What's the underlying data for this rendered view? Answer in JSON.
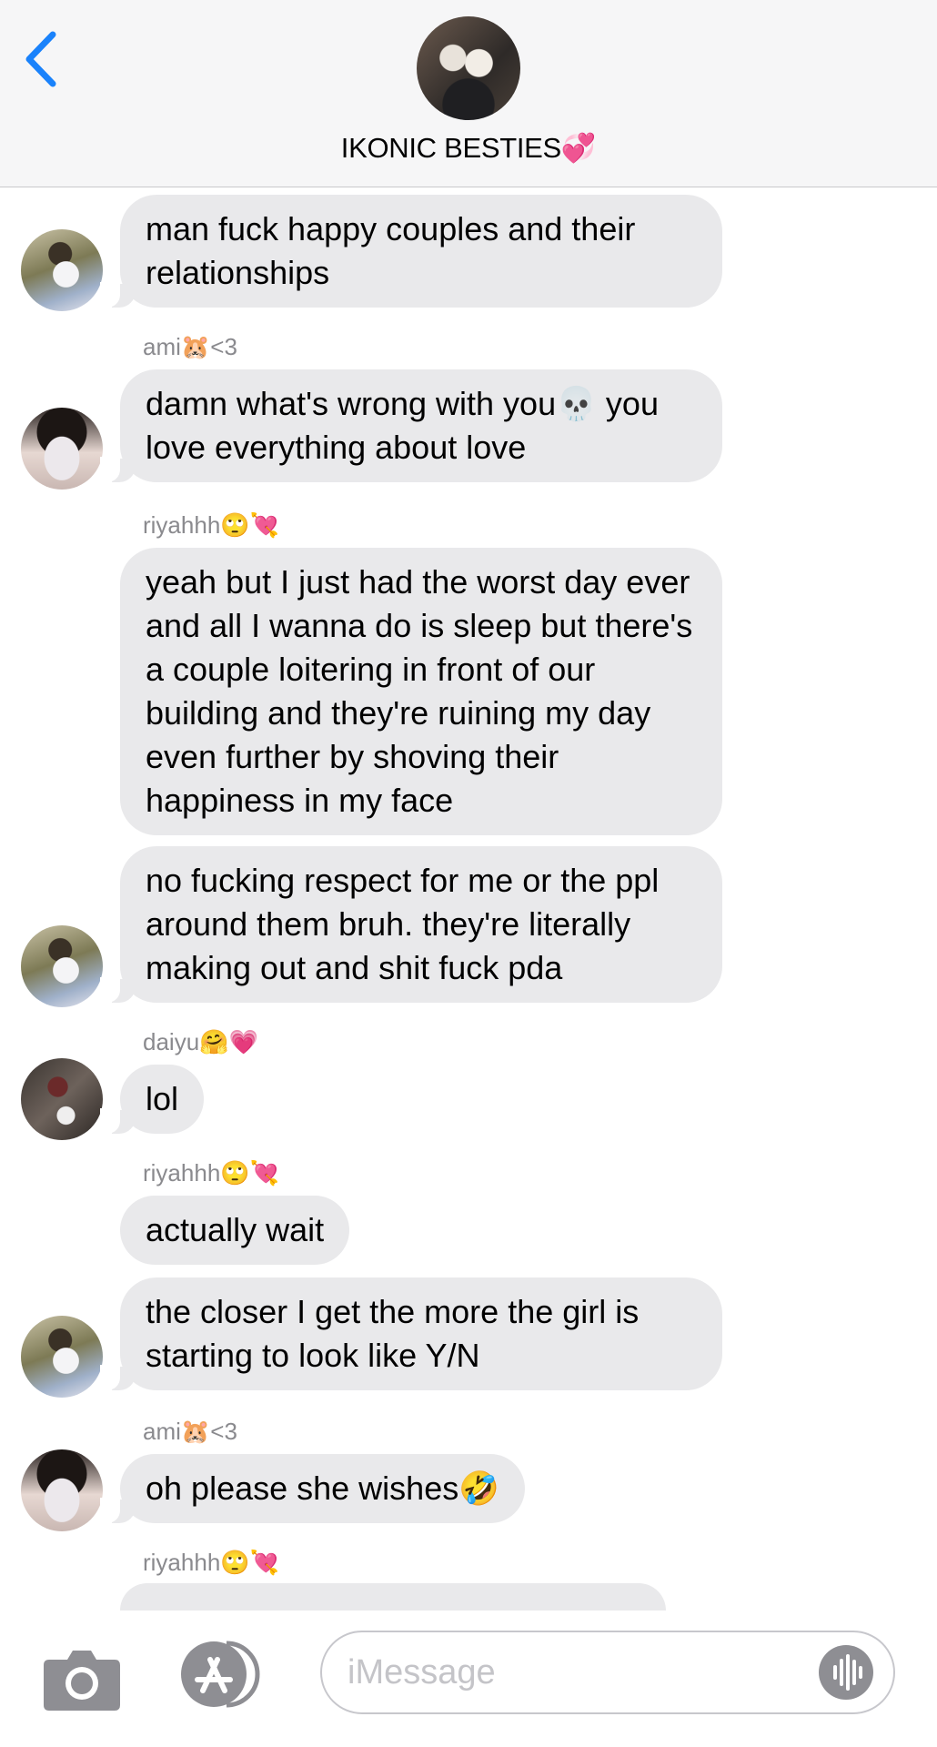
{
  "header": {
    "group_name": "IKONIC BESTIES💞",
    "accent_color": "#1a82fb"
  },
  "messages": [
    {
      "sender": "",
      "text": "man fuck happy couples and their relationships"
    },
    {
      "sender": "ami🐹<3",
      "text": "damn what's wrong with you💀 you love everything about love"
    },
    {
      "sender": "riyahhh🙄💘",
      "text": "yeah but I just had the worst day ever and all I wanna do is sleep but there's a couple loitering in front of our building and they're ruining my day even further by shoving their happiness in my face"
    },
    {
      "sender": "",
      "text": "no fucking respect for me or the ppl around them bruh. they're literally making out and shit fuck pda"
    },
    {
      "sender": "daiyu🤗💗",
      "text": "lol"
    },
    {
      "sender": "riyahhh🙄💘",
      "text": "actually wait"
    },
    {
      "sender": "",
      "text": "the closer I get the more the girl is starting to look like Y/N"
    },
    {
      "sender": "ami🐹<3",
      "text": "oh please she wishes🤣"
    },
    {
      "sender": "riyahhh🙄💘",
      "text": ""
    }
  ],
  "composer": {
    "placeholder": "iMessage"
  },
  "icons": {
    "back": "chevron-left-icon",
    "camera": "camera-icon",
    "apps": "app-store-icon",
    "voice": "waveform-icon"
  }
}
